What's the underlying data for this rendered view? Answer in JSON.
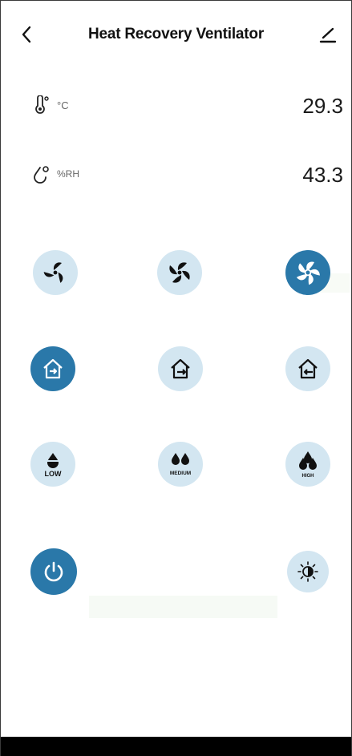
{
  "header": {
    "title": "Heat Recovery Ventilator",
    "back_icon": "chevron-left-icon",
    "edit_icon": "pencil-icon"
  },
  "readings": {
    "temperature": {
      "unit": "°C",
      "value": "29.3",
      "icon": "thermometer-icon"
    },
    "humidity": {
      "unit": "%RH",
      "value": "43.3",
      "icon": "humidity-drop-icon"
    }
  },
  "fan_speed": {
    "options": [
      "fan-low-icon",
      "fan-medium-icon",
      "fan-high-icon"
    ],
    "active_index": 2
  },
  "modes": {
    "options": [
      "mode-exchange-icon",
      "mode-exhaust-icon",
      "mode-supply-icon"
    ],
    "active_index": 0
  },
  "humidity_level": {
    "labels": {
      "low": "LOW",
      "medium": "MEDIUM",
      "high": "HIGH"
    }
  },
  "colors": {
    "accent": "#2a78a9",
    "button_inactive": "#d3e6f1",
    "text": "#111111"
  }
}
